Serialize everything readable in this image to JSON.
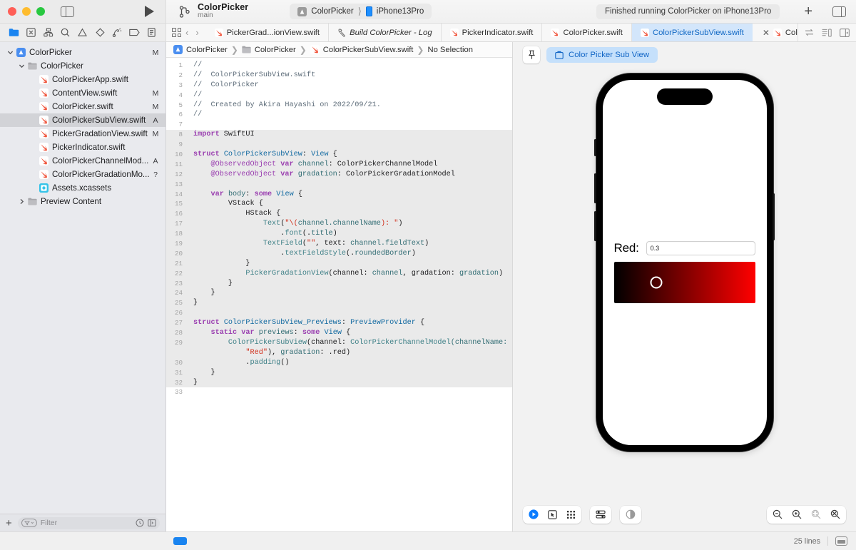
{
  "window": {
    "traffic_lights": [
      "close",
      "minimize",
      "zoom"
    ],
    "project_name": "ColorPicker",
    "branch": "main",
    "scheme": "ColorPicker",
    "destination": "iPhone13Pro",
    "status": "Finished running ColorPicker on iPhone13Pro",
    "add_label": "+"
  },
  "nav_icons": [
    {
      "name": "project-navigator-icon",
      "label": "Project"
    },
    {
      "name": "source-control-navigator-icon",
      "label": "Source Control"
    },
    {
      "name": "symbol-navigator-icon",
      "label": "Symbols"
    },
    {
      "name": "find-navigator-icon",
      "label": "Find"
    },
    {
      "name": "issue-navigator-icon",
      "label": "Issues"
    },
    {
      "name": "test-navigator-icon",
      "label": "Tests"
    },
    {
      "name": "debug-navigator-icon",
      "label": "Debug"
    },
    {
      "name": "breakpoint-navigator-icon",
      "label": "Breakpoints"
    },
    {
      "name": "report-navigator-icon",
      "label": "Reports"
    }
  ],
  "tabs": [
    {
      "label": "PickerGrad...ionView.swift",
      "icon": "swift-file-icon",
      "selected": false,
      "italic": false
    },
    {
      "label": "Build ColorPicker - Log",
      "icon": "hammer-icon",
      "selected": false,
      "italic": true
    },
    {
      "label": "PickerIndicator.swift",
      "icon": "swift-file-icon",
      "selected": false,
      "italic": false
    },
    {
      "label": "ColorPicker.swift",
      "icon": "swift-file-icon",
      "selected": false,
      "italic": false
    },
    {
      "label": "ColorPickerSubView.swift",
      "icon": "swift-file-icon",
      "selected": true,
      "italic": false
    },
    {
      "label": "Color",
      "icon": "swift-file-icon",
      "selected": false,
      "italic": false
    }
  ],
  "editor_controls": [
    {
      "name": "related-items-icon"
    },
    {
      "name": "back-chevron-icon"
    },
    {
      "name": "forward-chevron-icon"
    },
    {
      "name": "code-review-icon"
    },
    {
      "name": "editor-options-icon"
    },
    {
      "name": "add-editor-icon"
    }
  ],
  "navigator": {
    "items": [
      {
        "label": "ColorPicker",
        "icon": "xcode-project-icon",
        "indent": 0,
        "twisty": "open",
        "status": "M",
        "selected": false
      },
      {
        "label": "ColorPicker",
        "icon": "folder-icon",
        "indent": 1,
        "twisty": "open",
        "status": "",
        "selected": false
      },
      {
        "label": "ColorPickerApp.swift",
        "icon": "swift-file-icon",
        "indent": 2,
        "twisty": "",
        "status": "",
        "selected": false
      },
      {
        "label": "ContentView.swift",
        "icon": "swift-file-icon",
        "indent": 2,
        "twisty": "",
        "status": "M",
        "selected": false
      },
      {
        "label": "ColorPicker.swift",
        "icon": "swift-file-icon",
        "indent": 2,
        "twisty": "",
        "status": "M",
        "selected": false
      },
      {
        "label": "ColorPickerSubView.swift",
        "icon": "swift-file-icon",
        "indent": 2,
        "twisty": "",
        "status": "A",
        "selected": true
      },
      {
        "label": "PickerGradationView.swift",
        "icon": "swift-file-icon",
        "indent": 2,
        "twisty": "",
        "status": "M",
        "selected": false
      },
      {
        "label": "PickerIndicator.swift",
        "icon": "swift-file-icon",
        "indent": 2,
        "twisty": "",
        "status": "",
        "selected": false
      },
      {
        "label": "ColorPickerChannelMod...",
        "icon": "swift-file-icon",
        "indent": 2,
        "twisty": "",
        "status": "A",
        "selected": false
      },
      {
        "label": "ColorPickerGradationMo...",
        "icon": "swift-file-icon",
        "indent": 2,
        "twisty": "",
        "status": "?",
        "selected": false
      },
      {
        "label": "Assets.xcassets",
        "icon": "assets-icon",
        "indent": 2,
        "twisty": "",
        "status": "",
        "selected": false
      },
      {
        "label": "Preview Content",
        "icon": "folder-icon",
        "indent": 1,
        "twisty": "closed",
        "status": "",
        "selected": false
      }
    ],
    "footer": {
      "add_label": "+",
      "filter_placeholder": "Filter",
      "recent_icon": "clock-icon",
      "source_control_icon": "source-control-filter-icon"
    }
  },
  "breadcrumb": [
    {
      "label": "ColorPicker",
      "icon": "xcode-project-icon"
    },
    {
      "label": "ColorPicker",
      "icon": "folder-icon"
    },
    {
      "label": "ColorPickerSubView.swift",
      "icon": "swift-file-icon"
    },
    {
      "label": "No Selection",
      "icon": ""
    }
  ],
  "code": {
    "language": "swift",
    "lines": [
      {
        "n": 1,
        "hl": false,
        "tokens": [
          {
            "t": "//",
            "c": "cm"
          }
        ]
      },
      {
        "n": 2,
        "hl": false,
        "tokens": [
          {
            "t": "//  ColorPickerSubView.swift",
            "c": "cm"
          }
        ]
      },
      {
        "n": 3,
        "hl": false,
        "tokens": [
          {
            "t": "//  ColorPicker",
            "c": "cm"
          }
        ]
      },
      {
        "n": 4,
        "hl": false,
        "tokens": [
          {
            "t": "//",
            "c": "cm"
          }
        ]
      },
      {
        "n": 5,
        "hl": false,
        "tokens": [
          {
            "t": "//  Created by Akira Hayashi on 2022/09/21.",
            "c": "cm"
          }
        ]
      },
      {
        "n": 6,
        "hl": false,
        "tokens": [
          {
            "t": "//",
            "c": "cm"
          }
        ]
      },
      {
        "n": 7,
        "hl": false,
        "tokens": []
      },
      {
        "n": 8,
        "hl": true,
        "tokens": [
          {
            "t": "import",
            "c": "kw"
          },
          {
            "t": " SwiftUI",
            "c": "pln"
          }
        ]
      },
      {
        "n": 9,
        "hl": true,
        "tokens": []
      },
      {
        "n": 10,
        "hl": true,
        "tokens": [
          {
            "t": "struct",
            "c": "kw"
          },
          {
            "t": " ",
            "c": "pln"
          },
          {
            "t": "ColorPickerSubView",
            "c": "ty"
          },
          {
            "t": ": ",
            "c": "pln"
          },
          {
            "t": "View",
            "c": "ty"
          },
          {
            "t": " {",
            "c": "pln"
          }
        ]
      },
      {
        "n": 11,
        "hl": true,
        "tokens": [
          {
            "t": "    ",
            "c": "pln"
          },
          {
            "t": "@ObservedObject",
            "c": "attr"
          },
          {
            "t": " ",
            "c": "pln"
          },
          {
            "t": "var",
            "c": "kw"
          },
          {
            "t": " ",
            "c": "pln"
          },
          {
            "t": "channel",
            "c": "id"
          },
          {
            "t": ": ColorPickerChannelModel",
            "c": "pln"
          }
        ]
      },
      {
        "n": 12,
        "hl": true,
        "tokens": [
          {
            "t": "    ",
            "c": "pln"
          },
          {
            "t": "@ObservedObject",
            "c": "attr"
          },
          {
            "t": " ",
            "c": "pln"
          },
          {
            "t": "var",
            "c": "kw"
          },
          {
            "t": " ",
            "c": "pln"
          },
          {
            "t": "gradation",
            "c": "id"
          },
          {
            "t": ": ColorPickerGradationModel",
            "c": "pln"
          }
        ]
      },
      {
        "n": 13,
        "hl": true,
        "tokens": []
      },
      {
        "n": 14,
        "hl": true,
        "tokens": [
          {
            "t": "    ",
            "c": "pln"
          },
          {
            "t": "var",
            "c": "kw"
          },
          {
            "t": " ",
            "c": "pln"
          },
          {
            "t": "body",
            "c": "id"
          },
          {
            "t": ": ",
            "c": "pln"
          },
          {
            "t": "some",
            "c": "kw"
          },
          {
            "t": " ",
            "c": "pln"
          },
          {
            "t": "View",
            "c": "ty"
          },
          {
            "t": " {",
            "c": "pln"
          }
        ]
      },
      {
        "n": 15,
        "hl": true,
        "tokens": [
          {
            "t": "        VStack {",
            "c": "pln"
          }
        ]
      },
      {
        "n": 16,
        "hl": true,
        "tokens": [
          {
            "t": "            HStack {",
            "c": "pln"
          }
        ]
      },
      {
        "n": 17,
        "hl": true,
        "tokens": [
          {
            "t": "                ",
            "c": "pln"
          },
          {
            "t": "Text",
            "c": "mth"
          },
          {
            "t": "(",
            "c": "pln"
          },
          {
            "t": "\"\\(",
            "c": "str"
          },
          {
            "t": "channel.channelName",
            "c": "id"
          },
          {
            "t": "): \"",
            "c": "str"
          },
          {
            "t": ")",
            "c": "pln"
          }
        ]
      },
      {
        "n": 18,
        "hl": true,
        "tokens": [
          {
            "t": "                    .",
            "c": "pln"
          },
          {
            "t": "font",
            "c": "mth"
          },
          {
            "t": "(.",
            "c": "pln"
          },
          {
            "t": "title",
            "c": "id"
          },
          {
            "t": ")",
            "c": "pln"
          }
        ]
      },
      {
        "n": 19,
        "hl": true,
        "tokens": [
          {
            "t": "                ",
            "c": "pln"
          },
          {
            "t": "TextField",
            "c": "mth"
          },
          {
            "t": "(",
            "c": "pln"
          },
          {
            "t": "\"\"",
            "c": "str"
          },
          {
            "t": ", text: ",
            "c": "pln"
          },
          {
            "t": "channel.fieldText",
            "c": "id"
          },
          {
            "t": ")",
            "c": "pln"
          }
        ]
      },
      {
        "n": 20,
        "hl": true,
        "tokens": [
          {
            "t": "                    .",
            "c": "pln"
          },
          {
            "t": "textFieldStyle",
            "c": "mth"
          },
          {
            "t": "(.",
            "c": "pln"
          },
          {
            "t": "roundedBorder",
            "c": "id"
          },
          {
            "t": ")",
            "c": "pln"
          }
        ]
      },
      {
        "n": 21,
        "hl": true,
        "tokens": [
          {
            "t": "            }",
            "c": "pln"
          }
        ]
      },
      {
        "n": 22,
        "hl": true,
        "tokens": [
          {
            "t": "            ",
            "c": "pln"
          },
          {
            "t": "PickerGradationView",
            "c": "mth"
          },
          {
            "t": "(channel: ",
            "c": "pln"
          },
          {
            "t": "channel",
            "c": "id"
          },
          {
            "t": ", gradation: ",
            "c": "pln"
          },
          {
            "t": "gradation",
            "c": "id"
          },
          {
            "t": ")",
            "c": "pln"
          }
        ]
      },
      {
        "n": 23,
        "hl": true,
        "tokens": [
          {
            "t": "        }",
            "c": "pln"
          }
        ]
      },
      {
        "n": 24,
        "hl": true,
        "tokens": [
          {
            "t": "    }",
            "c": "pln"
          }
        ]
      },
      {
        "n": 25,
        "hl": true,
        "tokens": [
          {
            "t": "}",
            "c": "pln"
          }
        ]
      },
      {
        "n": 26,
        "hl": true,
        "tokens": []
      },
      {
        "n": 27,
        "hl": true,
        "tokens": [
          {
            "t": "struct",
            "c": "kw"
          },
          {
            "t": " ",
            "c": "pln"
          },
          {
            "t": "ColorPickerSubView_Previews",
            "c": "ty"
          },
          {
            "t": ": ",
            "c": "pln"
          },
          {
            "t": "PreviewProvider",
            "c": "ty"
          },
          {
            "t": " {",
            "c": "pln"
          }
        ]
      },
      {
        "n": 28,
        "hl": true,
        "tokens": [
          {
            "t": "    ",
            "c": "pln"
          },
          {
            "t": "static",
            "c": "kw"
          },
          {
            "t": " ",
            "c": "pln"
          },
          {
            "t": "var",
            "c": "kw"
          },
          {
            "t": " ",
            "c": "pln"
          },
          {
            "t": "previews",
            "c": "id"
          },
          {
            "t": ": ",
            "c": "pln"
          },
          {
            "t": "some",
            "c": "kw"
          },
          {
            "t": " ",
            "c": "pln"
          },
          {
            "t": "View",
            "c": "ty"
          },
          {
            "t": " {",
            "c": "pln"
          }
        ]
      },
      {
        "n": 29,
        "hl": true,
        "tokens": [
          {
            "t": "        ",
            "c": "pln"
          },
          {
            "t": "ColorPickerSubView",
            "c": "mth"
          },
          {
            "t": "(channel: ",
            "c": "pln"
          },
          {
            "t": "ColorPickerChannelModel",
            "c": "mth"
          },
          {
            "t": "(channelName:",
            "c": "id"
          }
        ]
      },
      {
        "n": "",
        "hl": true,
        "tokens": [
          {
            "t": "            ",
            "c": "pln"
          },
          {
            "t": "\"Red\"",
            "c": "str"
          },
          {
            "t": "), ",
            "c": "pln"
          },
          {
            "t": "gradation",
            "c": "id"
          },
          {
            "t": ": .red)",
            "c": "pln"
          }
        ]
      },
      {
        "n": 30,
        "hl": true,
        "tokens": [
          {
            "t": "            .",
            "c": "pln"
          },
          {
            "t": "padding",
            "c": "mth"
          },
          {
            "t": "()",
            "c": "pln"
          }
        ]
      },
      {
        "n": 31,
        "hl": true,
        "tokens": [
          {
            "t": "    }",
            "c": "pln"
          }
        ]
      },
      {
        "n": 32,
        "hl": true,
        "tokens": [
          {
            "t": "}",
            "c": "pln"
          }
        ]
      },
      {
        "n": 33,
        "hl": false,
        "tokens": []
      }
    ]
  },
  "canvas": {
    "pin_icon": "pin-icon",
    "preview_name": "Color Picker Sub View",
    "preview_icon": "preview-file-icon",
    "device": "iPhone 13 Pro",
    "preview_content": {
      "label": "Red:",
      "field_value": "0.3",
      "gradient_from": "#000000",
      "gradient_to": "#ff0000",
      "thumb_position_pct": 30
    },
    "bottom_controls": [
      {
        "name": "play-live-preview-icon"
      },
      {
        "name": "selectable-preview-icon"
      },
      {
        "name": "variants-preview-icon"
      },
      {
        "name": "device-settings-icon"
      },
      {
        "name": "color-scheme-icon"
      }
    ],
    "zoom_controls": [
      {
        "name": "zoom-out-icon"
      },
      {
        "name": "zoom-in-icon"
      },
      {
        "name": "zoom-to-fit-icon"
      },
      {
        "name": "zoom-to-actual-size-icon"
      }
    ]
  },
  "statusbar": {
    "lines_label": "25 lines",
    "minimap_icon": "minimap-toggle-icon",
    "chip_color": "#1a84f0"
  },
  "colors": {
    "accent_blue": "#0a7cff",
    "tab_selected_bg": "#d3e6fb",
    "tab_selected_text": "#1068c4",
    "swift_orange": "#f05138",
    "navigator_bg": "#e9eaee",
    "canvas_bg": "#f2f2f2"
  }
}
